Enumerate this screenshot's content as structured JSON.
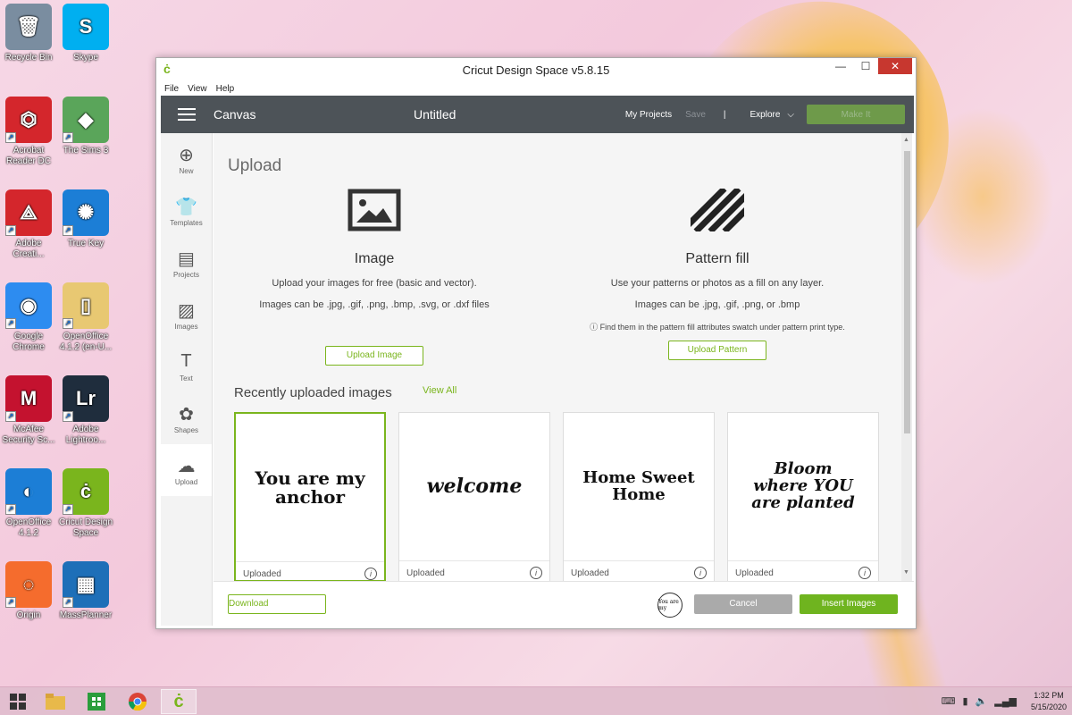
{
  "desktop": {
    "icons": [
      {
        "label": "Recycle Bin",
        "color": "#7a8da0"
      },
      {
        "label": "Skype",
        "color": "#00aff0"
      },
      {
        "label": "Acrobat Reader DC",
        "color": "#d4262c"
      },
      {
        "label": "The Sims 3",
        "color": "#5aa55a"
      },
      {
        "label": "Adobe Creati...",
        "color": "#d4262c"
      },
      {
        "label": "True Key",
        "color": "#1c7ed6"
      },
      {
        "label": "Google Chrome",
        "color": "#2d8cf0"
      },
      {
        "label": "OpenOffice 4.1.2 (en-U...",
        "color": "#e8c872"
      },
      {
        "label": "McAfee Security Sc...",
        "color": "#c4122f"
      },
      {
        "label": "Adobe Lightroo...",
        "color": "#1f2d3d"
      },
      {
        "label": "OpenOffice 4.1.2",
        "color": "#1c7ed6"
      },
      {
        "label": "Cricut Design Space",
        "color": "#7ab51d"
      },
      {
        "label": "Origin",
        "color": "#f56c2d"
      },
      {
        "label": "MassPlanner",
        "color": "#1e6fb8"
      }
    ]
  },
  "window": {
    "title": "Cricut Design Space  v5.8.15",
    "logo": "ċ",
    "minimize": "—",
    "maximize": "☐",
    "close": "✕",
    "menu": [
      "File",
      "View",
      "Help"
    ]
  },
  "appbar": {
    "section": "Canvas",
    "project_title": "Untitled",
    "my_projects": "My Projects",
    "save": "Save",
    "separator": "|",
    "explore": "Explore",
    "make_it": "Make It"
  },
  "sidebar": {
    "items": [
      {
        "label": "New",
        "icon": "⊕"
      },
      {
        "label": "Templates",
        "icon": "👕"
      },
      {
        "label": "Projects",
        "icon": "▤"
      },
      {
        "label": "Images",
        "icon": "▨"
      },
      {
        "label": "Text",
        "icon": "T"
      },
      {
        "label": "Shapes",
        "icon": "✿"
      },
      {
        "label": "Upload",
        "icon": "☁"
      }
    ]
  },
  "upload": {
    "heading": "Upload",
    "image": {
      "title": "Image",
      "desc": "Upload your images for free (basic and vector).",
      "formats": "Images can be .jpg, .gif, .png, .bmp, .svg, or .dxf files",
      "button": "Upload Image"
    },
    "pattern": {
      "title": "Pattern fill",
      "desc": "Use your patterns or photos as a fill on any layer.",
      "formats": "Images can be .jpg, .gif, .png, or .bmp",
      "note": "ⓘ Find them in the pattern fill attributes swatch under pattern print type.",
      "button": "Upload Pattern"
    }
  },
  "recent": {
    "heading": "Recently uploaded images",
    "view_all": "View All",
    "cards": [
      {
        "art": "You are my anchor",
        "label": "Uploaded",
        "info": "i"
      },
      {
        "art": "welcome",
        "label": "Uploaded",
        "info": "i"
      },
      {
        "art": "Home Sweet Home",
        "label": "Uploaded",
        "info": "i"
      },
      {
        "art": "Bloom where YOU are planted",
        "label": "Uploaded",
        "info": "i"
      }
    ]
  },
  "footer": {
    "download": "Download",
    "thumb_text": "You are my",
    "cancel": "Cancel",
    "insert": "Insert Images"
  },
  "taskbar": {
    "time": "1:32 PM",
    "date": "5/15/2020"
  }
}
